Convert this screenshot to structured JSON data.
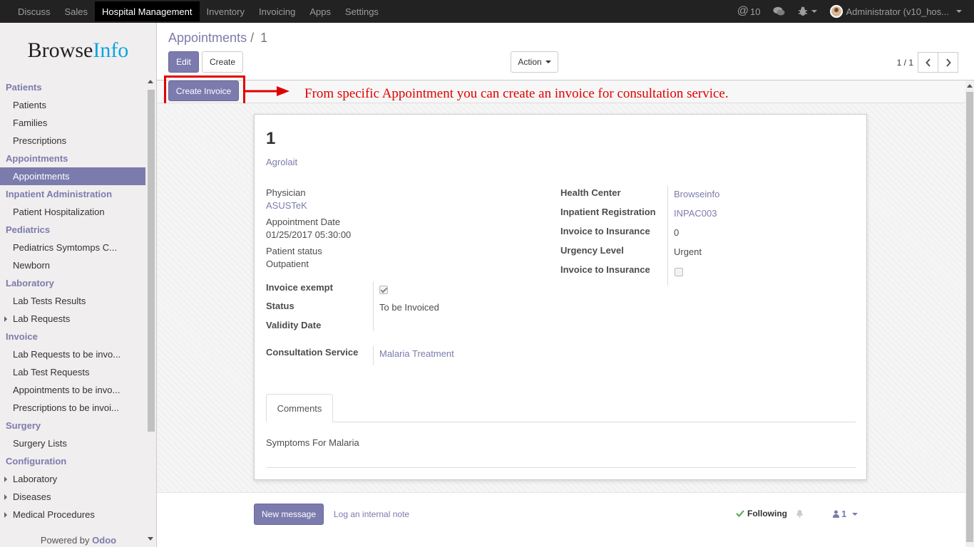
{
  "topnav": {
    "menus": [
      "Discuss",
      "Sales",
      "Hospital Management",
      "Inventory",
      "Invoicing",
      "Apps",
      "Settings"
    ],
    "active_index": 2,
    "mentions": "10",
    "user": "Administrator (v10_hos..."
  },
  "sidebar": {
    "logo_part1": "Browse",
    "logo_part2": "Info",
    "sections": [
      {
        "title": "Patients",
        "items": [
          "Patients",
          "Families",
          "Prescriptions"
        ]
      },
      {
        "title": "Appointments",
        "items": [
          "Appointments"
        ]
      },
      {
        "title": "Inpatient Administration",
        "items": [
          "Patient Hospitalization"
        ]
      },
      {
        "title": "Pediatrics",
        "items": [
          "Pediatrics Symtomps C...",
          "Newborn"
        ]
      },
      {
        "title": "Laboratory",
        "items": [
          "Lab Tests Results",
          "Lab Requests"
        ]
      },
      {
        "title": "Invoice",
        "items": [
          "Lab Requests to be invo...",
          "Lab Test Requests",
          "Appointments to be invo...",
          "Prescriptions to be invoi..."
        ]
      },
      {
        "title": "Surgery",
        "items": [
          "Surgery Lists"
        ]
      },
      {
        "title": "Configuration",
        "items": [
          "Laboratory",
          "Diseases",
          "Medical Procedures"
        ]
      }
    ],
    "powered_by": "Powered by",
    "powered_brand": "Odoo"
  },
  "control_panel": {
    "breadcrumb_parent": "Appointments",
    "breadcrumb_sep": "/",
    "breadcrumb_current": "1",
    "edit_label": "Edit",
    "create_label": "Create",
    "action_label": "Action",
    "pager_value": "1 / 1"
  },
  "statusbar": {
    "create_invoice_label": "Create Invoice"
  },
  "annotation": "From specific Appointment you can create an invoice for consultation service.",
  "form": {
    "record_name": "1",
    "patient": "Agrolait",
    "physician_label": "Physician",
    "physician_value": "ASUSTeK",
    "appt_date_label": "Appointment Date",
    "appt_date_value": "01/25/2017 05:30:00",
    "patient_status_label": "Patient status",
    "patient_status_value": "Outpatient",
    "invoice_exempt_label": "Invoice exempt",
    "invoice_exempt_checked": true,
    "status_label": "Status",
    "status_value": "To be Invoiced",
    "validity_label": "Validity Date",
    "consultation_label": "Consultation Service",
    "consultation_value": "Malaria Treatment",
    "health_center_label": "Health Center",
    "health_center_value": "Browseinfo",
    "inpatient_reg_label": "Inpatient Registration",
    "inpatient_reg_value": "INPAC003",
    "inv_ins_label_1": "Invoice to Insurance",
    "inv_ins_value_1": "0",
    "urgency_label": "Urgency Level",
    "urgency_value": "Urgent",
    "inv_ins_label_2": "Invoice to Insurance",
    "inv_ins_checked": false,
    "comments_tab": "Comments",
    "comments_text": "Symptoms For Malaria"
  },
  "chatter": {
    "new_message": "New message",
    "log_note": "Log an internal note",
    "following": "Following",
    "followers": "1"
  }
}
